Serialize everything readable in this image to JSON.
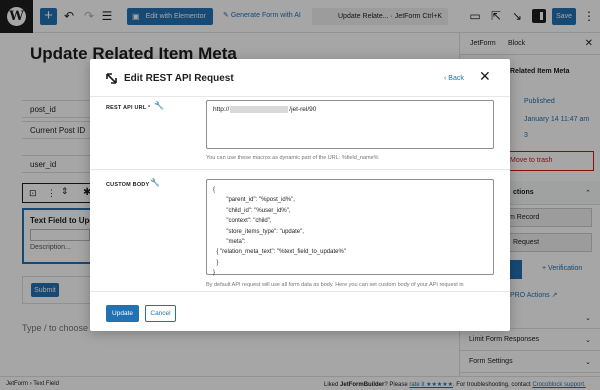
{
  "toolbar": {
    "elementor_label": "Edit with Elementor",
    "generate_label": "Generate Form with AI",
    "doc_title": "Update Relate... · JetForm",
    "shortcut": "Ctrl+K",
    "save_label": "Save"
  },
  "editor": {
    "page_title": "Update Related Item Meta",
    "fields": [
      "post_id",
      "Current Post ID",
      "user_id"
    ],
    "text_block_title": "Text Field to Upda",
    "text_block_desc": "Description...",
    "submit_label": "Submit",
    "type_choose": "Type / to choose"
  },
  "sidebar": {
    "tab_jetform": "JetForm",
    "tab_block": "Block",
    "title_frag": "Related Item Meta",
    "status": "Published",
    "date": "January 14 11:47 am",
    "revisions": "3",
    "trash": "Move to trash",
    "actions_frag": "ctions",
    "item_record": "m Record",
    "request": "Request",
    "verification": "Verification",
    "pro_actions": "PRO Actions",
    "limit": "Limit Form Responses",
    "settings": "Form Settings"
  },
  "statusbar": {
    "crumb1": "JetForm",
    "crumb2": "Text Field",
    "liked_pre": "Liked",
    "liked_brand": "JetFormBuilder",
    "liked_mid": "? Please",
    "rate": "rate it ★★★★★",
    "liked_tail": ". For troubleshooting, contact",
    "support": "Crocoblock support."
  },
  "modal": {
    "title": "Edit REST API Request",
    "back": "Back",
    "url_label": "REST API URL",
    "url_prefix": "http://",
    "url_suffix": "/jet-rel/90",
    "url_help": "You can use these macros as dynamic part of the URL: %field_name%",
    "body_label": "CUSTOM BODY",
    "body_lines": [
      "{",
      "        \"parent_id\": \"%post_id%\",",
      "        \"child_id\": \"%user_id%\",",
      "        \"context\": \"child\",",
      "        \"store_items_type\": \"update\",",
      "        \"meta\":",
      "  { \"relation_meta_text\": \"%text_field_to_update%\"",
      "  }",
      "}"
    ],
    "body_help": "By default API request will use all form data as body. Here you can set custom body of your API request in",
    "update_label": "Update",
    "cancel_label": "Cancel"
  },
  "colors": {
    "accent": "#2271b1",
    "danger": "#cc1818",
    "overlay": "rgba(0,0,0,0.35)"
  }
}
